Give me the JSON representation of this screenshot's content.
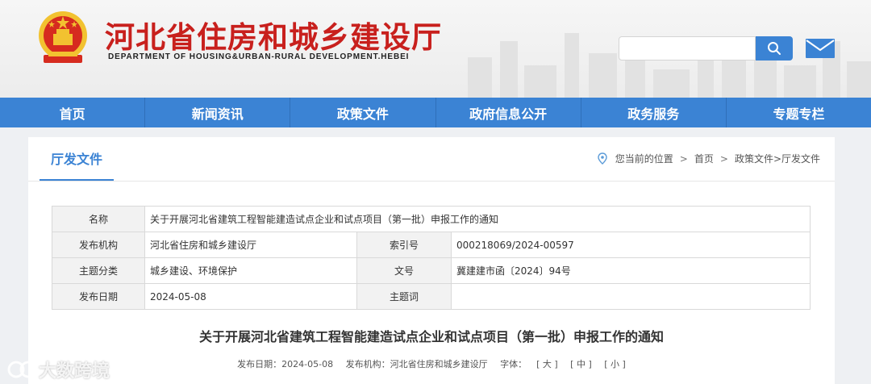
{
  "site": {
    "title": "河北省住房和城乡建设厅",
    "subtitle": "DEPARTMENT OF HOUSING&URBAN-RURAL DEVELOPMENT.HEBEI"
  },
  "search": {
    "value": "",
    "placeholder": ""
  },
  "nav": [
    "首页",
    "新闻资讯",
    "政策文件",
    "政府信息公开",
    "政务服务",
    "专题专栏"
  ],
  "category": "厅发文件",
  "breadcrumb": {
    "prefix": "您当前的位置",
    "home": "首页",
    "path": "政策文件>厅发文件"
  },
  "meta": {
    "name_label": "名称",
    "name": "关于开展河北省建筑工程智能建造试点企业和试点项目（第一批）申报工作的通知",
    "org_label": "发布机构",
    "org": "河北省住房和城乡建设厅",
    "index_label": "索引号",
    "index": "000218069/2024-00597",
    "topic_label": "主题分类",
    "topic": "城乡建设、环境保护",
    "docno_label": "文号",
    "docno": "冀建建市函〔2024〕94号",
    "date_label": "发布日期",
    "date": "2024-05-08",
    "keywords_label": "主题词",
    "keywords": ""
  },
  "article": {
    "title": "关于开展河北省建筑工程智能建造试点企业和试点项目（第一批）申报工作的通知",
    "date_text": "发布日期：2024-05-08",
    "org_text": "发布机构：河北省住房和城乡建设厅",
    "font_label": "字体：",
    "font_large": "[ 大 ]",
    "font_medium": "[ 中 ]",
    "font_small": "[ 小 ]"
  },
  "watermark": "大数跨境",
  "colors": {
    "brand_red": "#c8201d",
    "nav_blue": "#3b83d4"
  }
}
